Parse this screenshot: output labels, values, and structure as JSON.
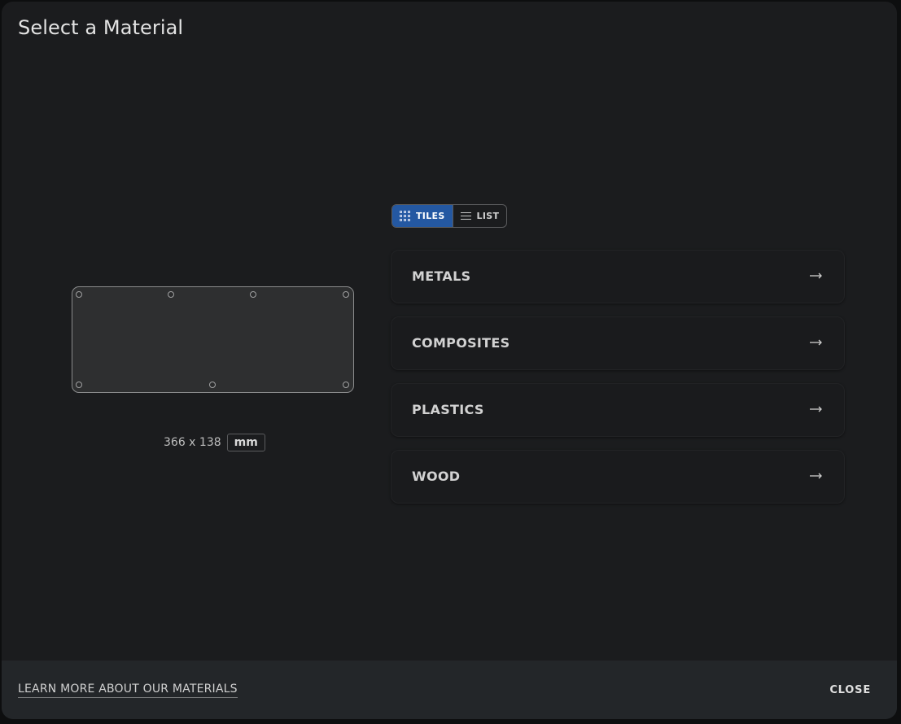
{
  "dialog": {
    "title": "Select a Material"
  },
  "preview": {
    "dimensions_text": "366 x 138",
    "unit_label": "mm"
  },
  "view_toggle": {
    "tiles_label": "TILES",
    "list_label": "LIST",
    "active": "tiles",
    "active_color": "#2458a2"
  },
  "materials": [
    {
      "label": "METALS",
      "icon": "arrow-right-icon"
    },
    {
      "label": "COMPOSITES",
      "icon": "arrow-right-icon"
    },
    {
      "label": "PLASTICS",
      "icon": "arrow-right-icon"
    },
    {
      "label": "WOOD",
      "icon": "arrow-right-icon"
    }
  ],
  "footer": {
    "learn_more_label": "LEARN MORE ABOUT OUR MATERIALS",
    "close_label": "CLOSE"
  }
}
